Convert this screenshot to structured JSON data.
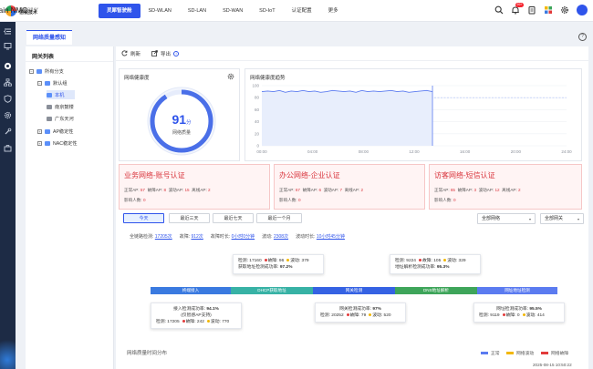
{
  "brand": {
    "company_en": "SUNDRAY",
    "company_cn": "信锐技术",
    "product": "iBrain NMC"
  },
  "nav": [
    {
      "label": "灵犀智驶舱",
      "active": true
    },
    {
      "label": "SD-WLAN",
      "active": false
    },
    {
      "label": "SD-LAN",
      "active": false
    },
    {
      "label": "SD-WAN",
      "active": false
    },
    {
      "label": "SD-IoT",
      "active": false
    },
    {
      "label": "认证配置",
      "active": false
    },
    {
      "label": "更多",
      "active": false
    }
  ],
  "notifications": {
    "badge": "99+"
  },
  "tab": {
    "label": "网络质量感知"
  },
  "help": {
    "label": "?"
  },
  "tree": {
    "title": "网关列表",
    "items": [
      {
        "label": "所有分支",
        "toggle": "−"
      },
      {
        "label": "默认组",
        "toggle": "−"
      },
      {
        "label": "本机",
        "selected": true
      },
      {
        "label": "南京鼓楼"
      },
      {
        "label": "广东天河"
      },
      {
        "label": "AP稳定性",
        "toggle": "+"
      },
      {
        "label": "NAC稳定性",
        "toggle": "+"
      }
    ]
  },
  "toolbar": {
    "refresh": "刷新",
    "export": "导出",
    "info": "i"
  },
  "health": {
    "title": "网络健康度",
    "score": "91",
    "unit": "分",
    "caption": "网络质量",
    "score_fraction": 0.91
  },
  "trend": {
    "title": "网络健康度趋势"
  },
  "chart_data": {
    "type": "line",
    "title": "网络健康度趋势",
    "x": [
      "00:00",
      "04:00",
      "08:00",
      "12:00",
      "16:00",
      "20:00",
      "24:00"
    ],
    "ylim": [
      0,
      100
    ],
    "yticks": [
      "100",
      "80",
      "60",
      "40",
      "20",
      "0"
    ],
    "series": [
      {
        "values": [
          90,
          91,
          90,
          92,
          89,
          91,
          90,
          92,
          90,
          91,
          89,
          90,
          92,
          91,
          90,
          91,
          89,
          92,
          90,
          91,
          90,
          91,
          92,
          90,
          91,
          89,
          90,
          91,
          92,
          90
        ]
      }
    ],
    "threshold": 80,
    "grid": true
  },
  "biz_cards": [
    {
      "title": "业务网络-账号认证",
      "row1": [
        "正常AP:",
        "57",
        "故障AP:",
        "8",
        "波动AP:",
        "15",
        "离线AP:",
        "2"
      ],
      "row2": [
        "影响人数:",
        "0"
      ]
    },
    {
      "title": "办公网络-企业认证",
      "row1": [
        "正常AP:",
        "67",
        "故障AP:",
        "6",
        "波动AP:",
        "7",
        "离线AP:",
        "2"
      ],
      "row2": [
        "影响人数:",
        "0"
      ]
    },
    {
      "title": "访客网络-短信认证",
      "row1": [
        "正常AP:",
        "65",
        "故障AP:",
        "3",
        "波动AP:",
        "12",
        "离线AP:",
        "2"
      ],
      "row2": [
        "影响人数:",
        "0"
      ]
    }
  ],
  "time_buttons": [
    "今天",
    "最近三天",
    "最近七天",
    "最近一个月"
  ],
  "filters": {
    "network": "全部网络",
    "gateway": "全部网关",
    "caret": "▾"
  },
  "stats": [
    {
      "label": "全链路检测:",
      "value": "17205次"
    },
    {
      "label": "故障:",
      "value": "912次"
    },
    {
      "label": "故障时长:",
      "value": "0小时0分钟"
    },
    {
      "label": "波动:",
      "value": "2308次"
    },
    {
      "label": "波动时长:",
      "value": "10小时45分钟"
    }
  ],
  "flow": [
    {
      "label": "终端接入",
      "color": "#3a7ae0"
    },
    {
      "label": "DHCP获取地址",
      "color": "#37b2a5"
    },
    {
      "label": "网关检测",
      "color": "#3562e3"
    },
    {
      "label": "DNS地址解析",
      "color": "#3ea55a"
    },
    {
      "label": "网址地址检测",
      "color": "#5b7bf0"
    }
  ],
  "boxes": {
    "dhcp": {
      "detect_label": "检测:",
      "detect": "17160",
      "fault_label": "故障:",
      "fault": "96",
      "wave_label": "波动:",
      "wave": "379",
      "rate_label": "获取地址检测成功率:",
      "rate": "97.2%"
    },
    "dns": {
      "detect_label": "检测:",
      "detect": "9224",
      "fault_label": "故障:",
      "fault": "105",
      "wave_label": "波动:",
      "wave": "329",
      "rate_label": "地址解析检测成功率:",
      "rate": "95.3%"
    },
    "access": {
      "rate_label": "接入检测成功率:",
      "rate": "94.1%",
      "note": "(仅智感AP支持)",
      "detect_label": "检测:",
      "detect": "17205",
      "fault_label": "故障:",
      "fault": "242",
      "wave_label": "波动:",
      "wave": "770"
    },
    "gateway": {
      "rate_label": "网关检测成功率:",
      "rate": "97%",
      "detect_label": "检测:",
      "detect": "20252",
      "fault_label": "故障:",
      "fault": "79",
      "wave_label": "波动:",
      "wave": "520"
    },
    "url": {
      "rate_label": "网址检测成功率:",
      "rate": "95.5%",
      "detect_label": "检测:",
      "detect": "9119",
      "fault_label": "故障:",
      "fault": "0",
      "wave_label": "波动:",
      "wave": "414"
    }
  },
  "dist": {
    "title": "网络质量时间分布"
  },
  "legend": [
    {
      "label": "正常",
      "color": "#5b7bf0"
    },
    {
      "label": "网络波动",
      "color": "#f2b705"
    },
    {
      "label": "网络故障",
      "color": "#e23b3b"
    }
  ],
  "footer": {
    "timestamp": "2025-08-15 10:50:22"
  },
  "colors": {
    "accent": "#2f54eb",
    "fault": "#e23b3b",
    "wave": "#f2b705"
  }
}
